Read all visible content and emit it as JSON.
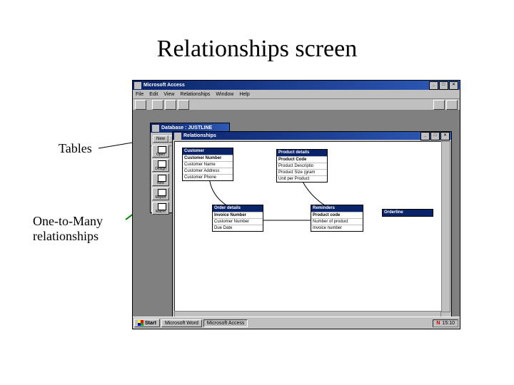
{
  "slide": {
    "title": "Relationships screen",
    "annotations": {
      "tables": "Tables",
      "one_to_many": "One-to-Many\nrelationships"
    }
  },
  "access": {
    "app_title": "Microsoft Access",
    "menubar": [
      "File",
      "Edit",
      "View",
      "Relationships",
      "Window",
      "Help"
    ],
    "db_window": {
      "title": "Database : JUSTLINE",
      "buttons": {
        "new": "New",
        "open": "Open",
        "design": "Design"
      },
      "side_items": [
        "Open",
        "Design",
        "New",
        "Report",
        "Macro"
      ]
    },
    "relationships_window": {
      "title": "Relationships",
      "tables": {
        "customer": {
          "name": "Customer",
          "pk": "Customer Number",
          "fields": [
            "Customer Name",
            "Customer Address",
            "Customer Phone"
          ]
        },
        "product_details": {
          "name": "Product details",
          "pk": "Product Code",
          "fields": [
            "Product Descriptio",
            "Product Size (gram",
            "Unit per Product"
          ]
        },
        "order_details": {
          "name": "Order details",
          "pk": "Invoice Number",
          "fields": [
            "Customer Number",
            "Due Date"
          ]
        },
        "reminders": {
          "name": "Reminders",
          "pk": "Product code",
          "fields": [
            "Number of product",
            "Invoice number"
          ]
        },
        "order_entry": {
          "name": "Orderline",
          "pk": "",
          "fields": []
        }
      }
    }
  },
  "taskbar": {
    "start": "Start",
    "tasks": {
      "word": "Microsoft Word",
      "access": "Microsoft Access"
    },
    "clock": "15:10"
  }
}
